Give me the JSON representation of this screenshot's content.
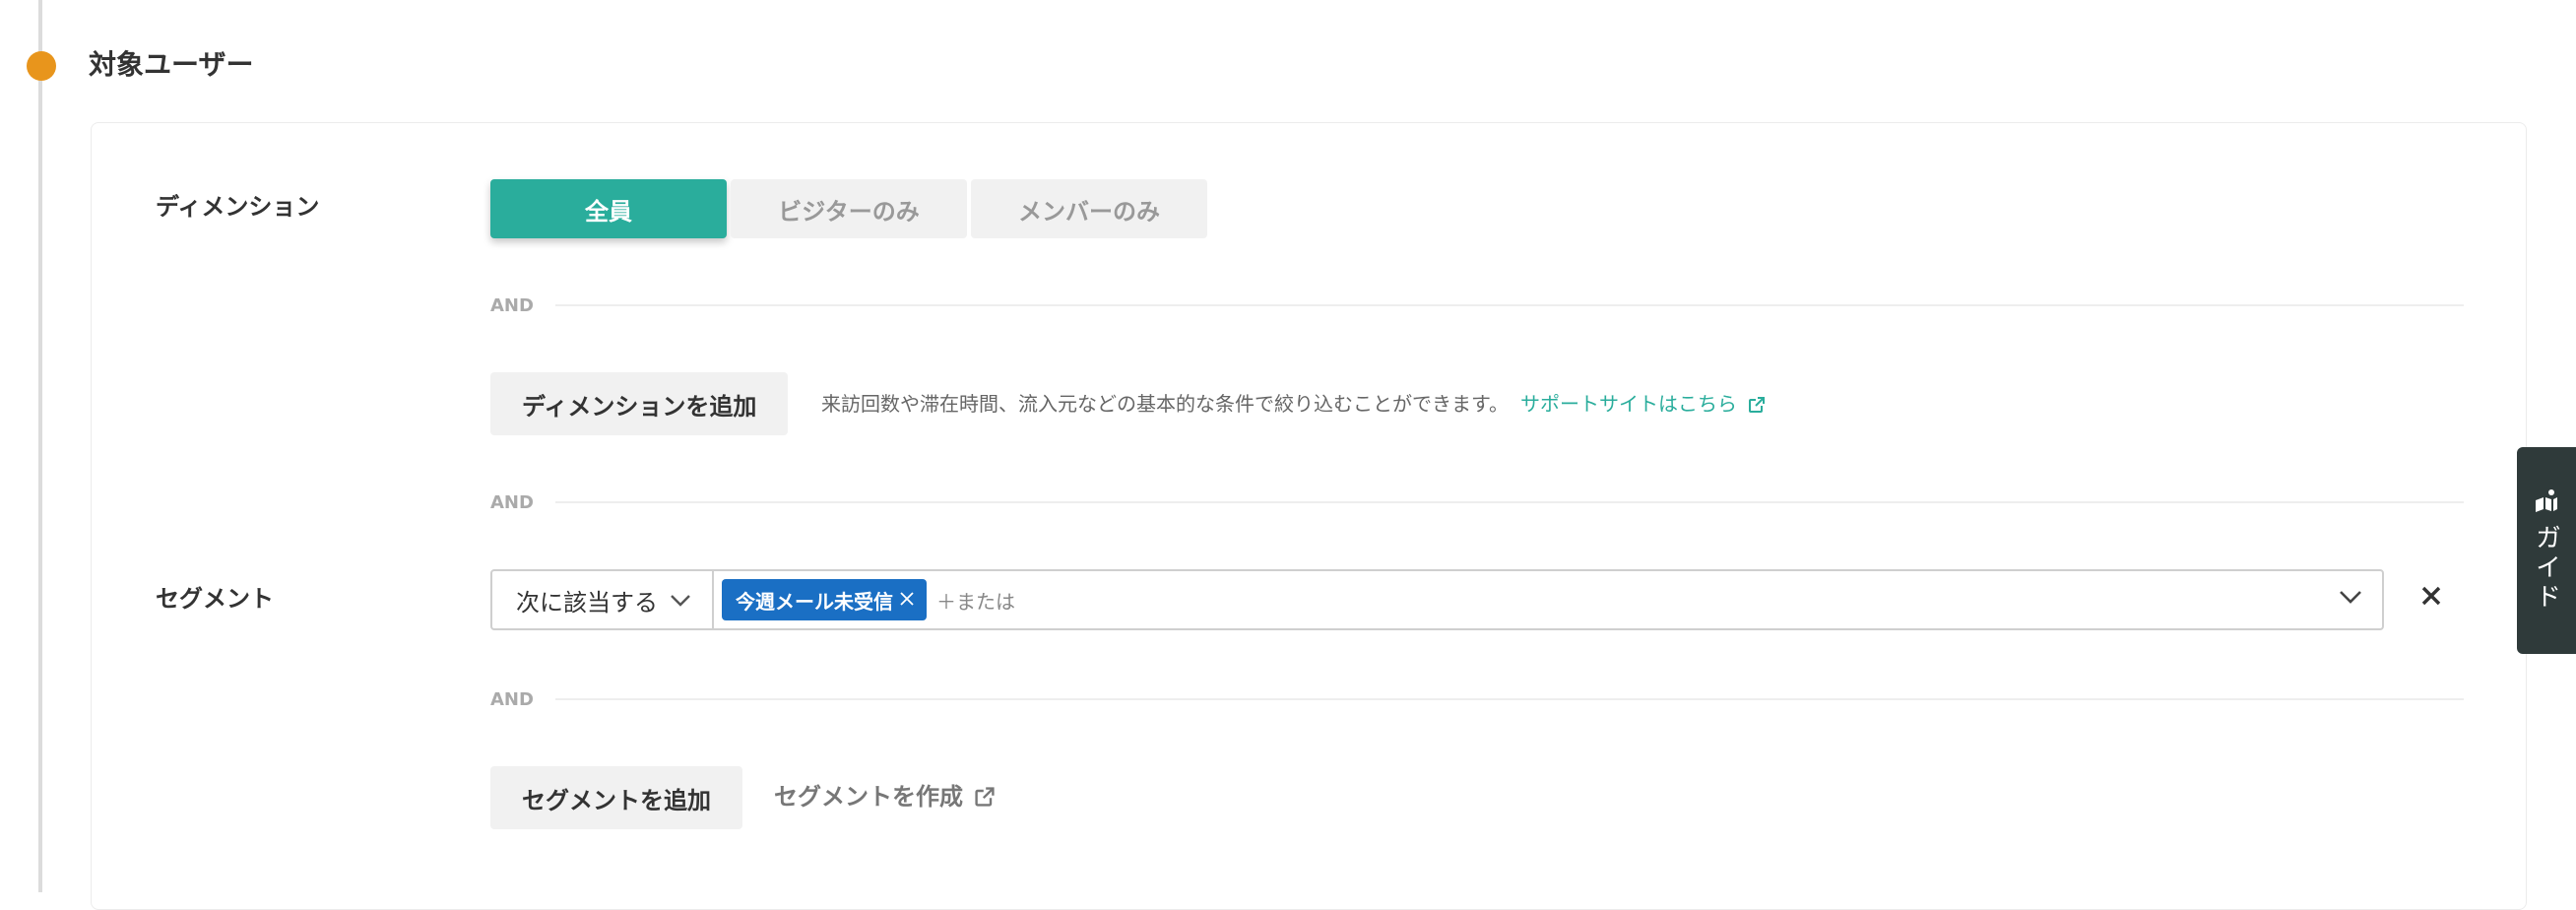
{
  "section": {
    "title": "対象ユーザー"
  },
  "dimension": {
    "label": "ディメンション",
    "options": [
      "全員",
      "ビジターのみ",
      "メンバーのみ"
    ],
    "selected": "全員",
    "add_label": "ディメンションを追加",
    "help_text": "来訪回数や滞在時間、流入元などの基本的な条件で絞り込むことができます。",
    "help_link": "サポートサイトはこちら"
  },
  "and_label": "AND",
  "segment": {
    "label": "セグメント",
    "condition": "次に該当する",
    "chips": [
      "今週メール未受信"
    ],
    "or_placeholder": "＋または",
    "add_label": "セグメントを追加",
    "create_label": "セグメントを作成"
  },
  "guide": {
    "label": "ガイド"
  },
  "colors": {
    "accent": "#2aad9c",
    "chip": "#1a6fc4",
    "timeline_dot": "#e8951c",
    "guide_bg": "#2f3a3a"
  },
  "icons": [
    "external-link-icon",
    "chevron-down-icon",
    "close-icon",
    "guide-icon"
  ]
}
